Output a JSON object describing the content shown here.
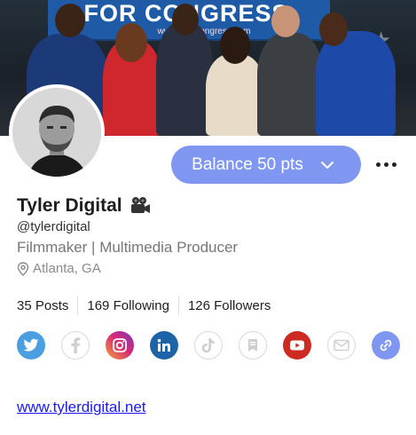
{
  "cover": {
    "banner_text": "FOR CONGRESS",
    "banner_url": "www.M...Congress.com"
  },
  "profile": {
    "name": "Tyler Digital",
    "handle": "@tylerdigital",
    "bio": "Filmmaker | Multimedia Producer",
    "location": "Atlanta, GA",
    "website": "www.tylerdigital.net"
  },
  "balance": {
    "label": "Balance 50 pts"
  },
  "stats": {
    "posts": "35 Posts",
    "following": "169 Following",
    "followers": "126 Followers"
  },
  "socials": [
    {
      "icon": "twitter-icon",
      "color": "#4b9fe1"
    },
    {
      "icon": "facebook-icon",
      "color": "#cfcfcf"
    },
    {
      "icon": "instagram-icon",
      "color": "#c13584"
    },
    {
      "icon": "linkedin-icon",
      "color": "#1d63a8"
    },
    {
      "icon": "tiktok-icon",
      "color": "#cfcfcf"
    },
    {
      "icon": "bookmark-icon",
      "color": "#cfcfcf"
    },
    {
      "icon": "youtube-icon",
      "color": "#cc2a22"
    },
    {
      "icon": "email-icon",
      "color": "#cfcfcf"
    },
    {
      "icon": "link-icon",
      "color": "#7f97f1"
    }
  ],
  "colors": {
    "accent": "#7f97f1",
    "link": "#1a1aee"
  }
}
